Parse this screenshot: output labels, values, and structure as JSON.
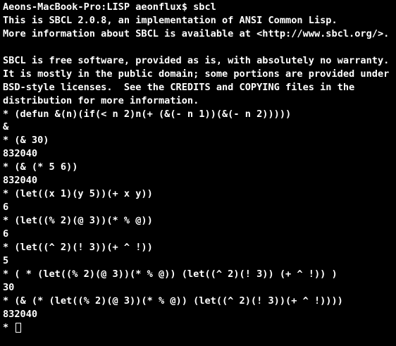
{
  "terminal": {
    "shell_prompt": "Aeons-MacBook-Pro:LISP aeonflux$ sbcl",
    "lines": [
      "This is SBCL 2.0.8, an implementation of ANSI Common Lisp.",
      "More information about SBCL is available at <http://www.sbcl.org/>.",
      "",
      "SBCL is free software, provided as is, with absolutely no warranty.",
      "It is mostly in the public domain; some portions are provided under",
      "BSD-style licenses.  See the CREDITS and COPYING files in the",
      "distribution for more information.",
      "* (defun &(n)(if(< n 2)n(+ (&(- n 1))(&(- n 2)))))",
      "&",
      "* (& 30)",
      "832040",
      "* (& (* 5 6))",
      "832040",
      "* (let((x 1)(y 5))(+ x y))",
      "6",
      "* (let((% 2)(@ 3))(* % @))",
      "6",
      "* (let((^ 2)(! 3))(+ ^ !))",
      "5",
      "* ( * (let((% 2)(@ 3))(* % @)) (let((^ 2)(! 3)) (+ ^ !)) )",
      "30",
      "* (& (* (let((% 2)(@ 3))(* % @)) (let((^ 2)(! 3))(+ ^ !))))",
      "832040"
    ],
    "final_prompt": "* ",
    "colors": {
      "background": "#000000",
      "foreground": "#ffffff"
    }
  }
}
